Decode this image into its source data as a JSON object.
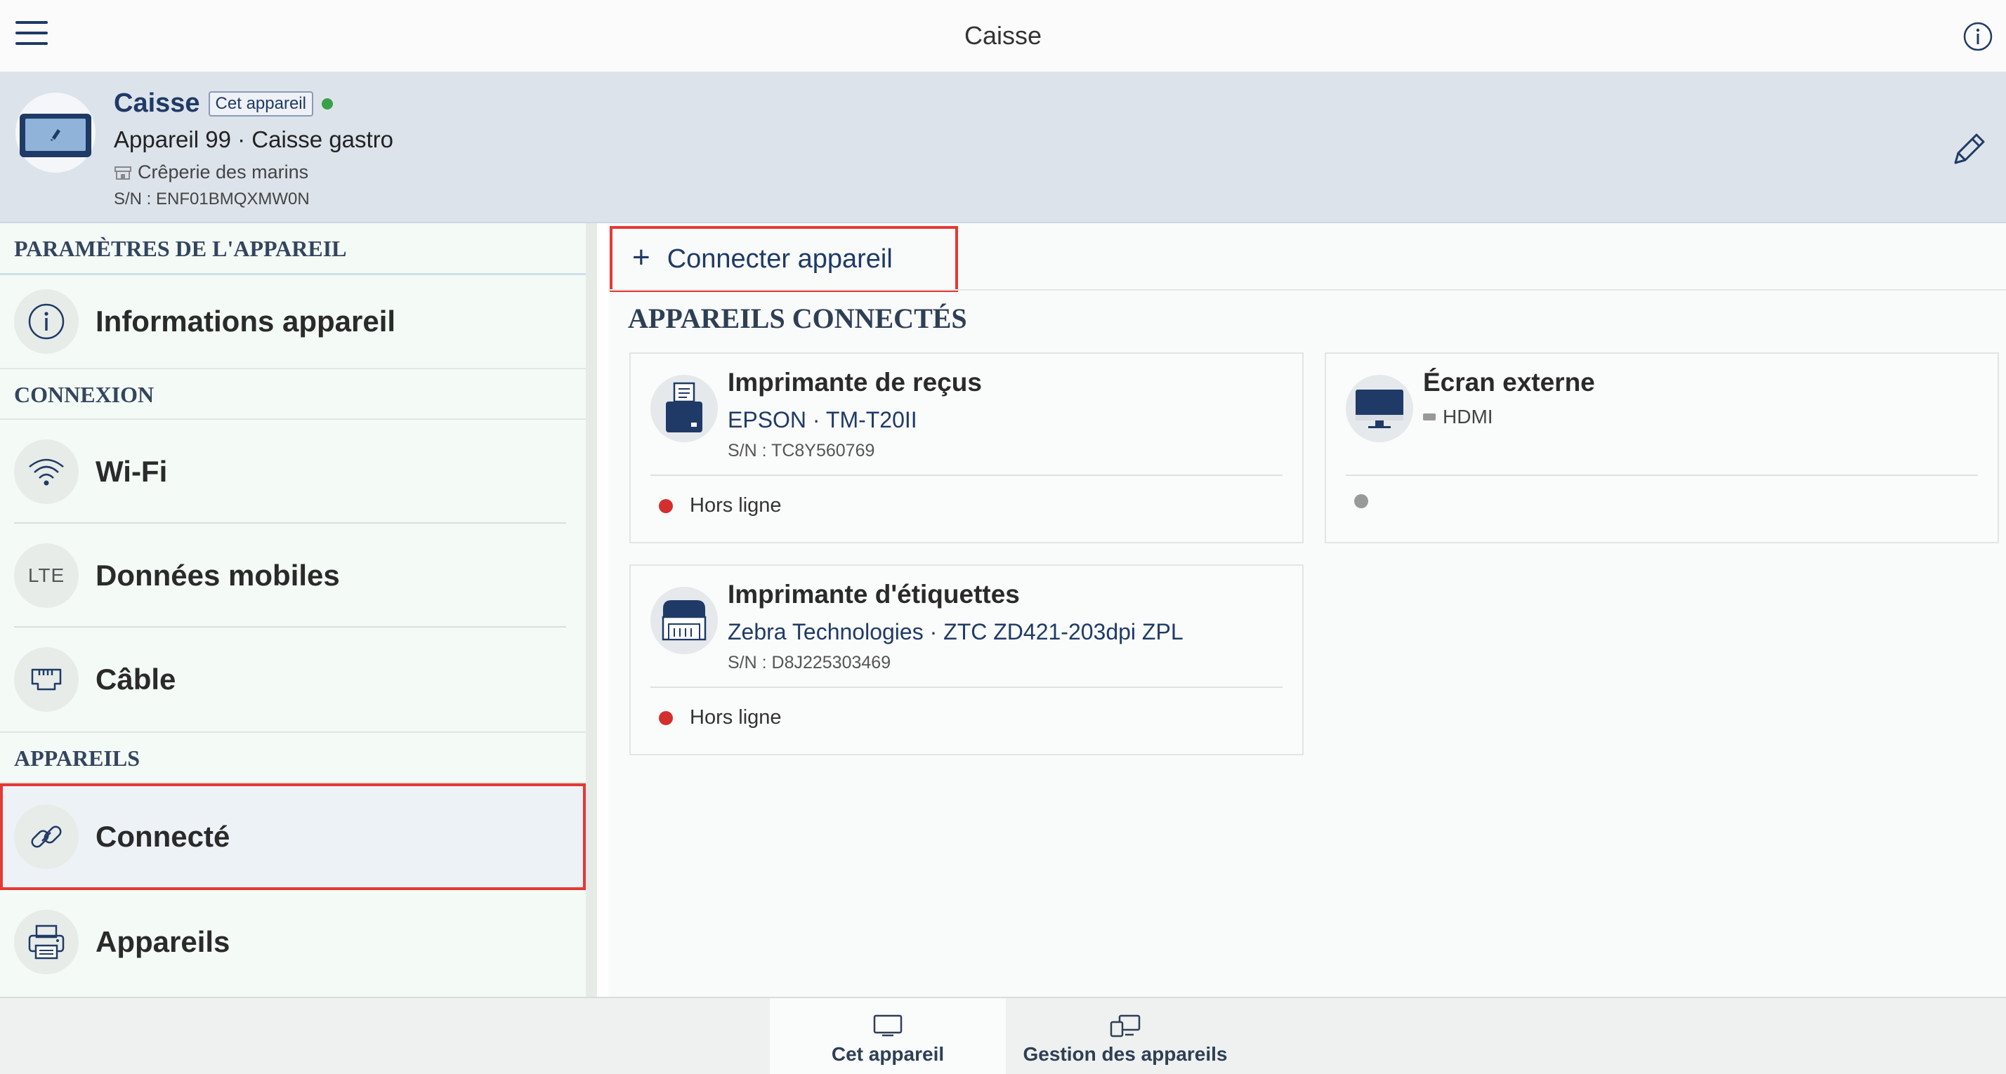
{
  "topbar": {
    "title": "Caisse"
  },
  "device": {
    "name": "Caisse",
    "badge": "Cet appareil",
    "model_line": "Appareil 99 · Caisse gastro",
    "location": "Crêperie des marins",
    "serial": "S/N : ENF01BMQXMW0N",
    "online_color": "#3aa04a"
  },
  "sidebar": {
    "sections": {
      "device_settings": "PARAMÈTRES DE L'APPAREIL",
      "connection": "CONNEXION",
      "devices": "APPAREILS"
    },
    "items": {
      "info": "Informations appareil",
      "wifi": "Wi-Fi",
      "mobile": "Données mobiles",
      "mobile_icon_text": "LTE",
      "cable": "Câble",
      "connected": "Connecté",
      "devices": "Appareils"
    }
  },
  "main": {
    "connect_button": "Connecter appareil",
    "connect_plus": "+",
    "section_title": "APPAREILS CONNECTÉS",
    "cards": [
      {
        "title": "Imprimante de reçus",
        "subtitle": "EPSON · TM-T20II",
        "serial": "S/N : TC8Y560769",
        "status": "Hors ligne",
        "status_color": "#d32f2f",
        "icon": "receipt-printer-icon"
      },
      {
        "title": "Écran externe",
        "subtitle": "HDMI",
        "serial": "",
        "status": "",
        "status_color": "#999999",
        "icon": "monitor-icon"
      },
      {
        "title": "Imprimante d'étiquettes",
        "subtitle": "Zebra Technologies · ZTC ZD421-203dpi ZPL",
        "serial": "S/N : D8J225303469",
        "status": "Hors ligne",
        "status_color": "#d32f2f",
        "icon": "label-printer-icon"
      }
    ]
  },
  "bottomnav": {
    "tabs": [
      {
        "label": "Cet appareil",
        "active": true
      },
      {
        "label": "Gestion des appareils",
        "active": false
      }
    ]
  },
  "colors": {
    "accent": "#1f3a66",
    "highlight": "#e53935"
  }
}
